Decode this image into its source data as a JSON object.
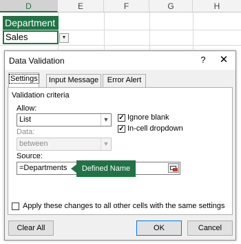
{
  "sheet": {
    "columns": [
      "D",
      "E",
      "F",
      "G",
      "H"
    ],
    "selected_column": "D",
    "cell_header": "Department",
    "cell_value": "Sales"
  },
  "dialog": {
    "title": "Data Validation",
    "help": "?",
    "close": "✕",
    "tabs": [
      "Settings",
      "Input Message",
      "Error Alert"
    ],
    "criteria_label": "Validation criteria",
    "allow_label": "Allow:",
    "allow_value": "List",
    "data_label": "Data:",
    "data_value": "between",
    "ignore_blank_label": "Ignore blank",
    "ignore_blank_checked": true,
    "in_cell_dropdown_label": "In-cell dropdown",
    "in_cell_dropdown_checked": true,
    "source_label": "Source:",
    "source_value": "=Departments",
    "apply_label": "Apply these changes to all other cells with the same settings",
    "clear_all": "Clear All",
    "ok": "OK",
    "cancel": "Cancel"
  },
  "callout": {
    "text": "Defined Name",
    "color": "#217346"
  },
  "colors": {
    "excel_green": "#217346",
    "dialog_bg": "#f0f0f0",
    "focus_blue": "#0078d7"
  }
}
